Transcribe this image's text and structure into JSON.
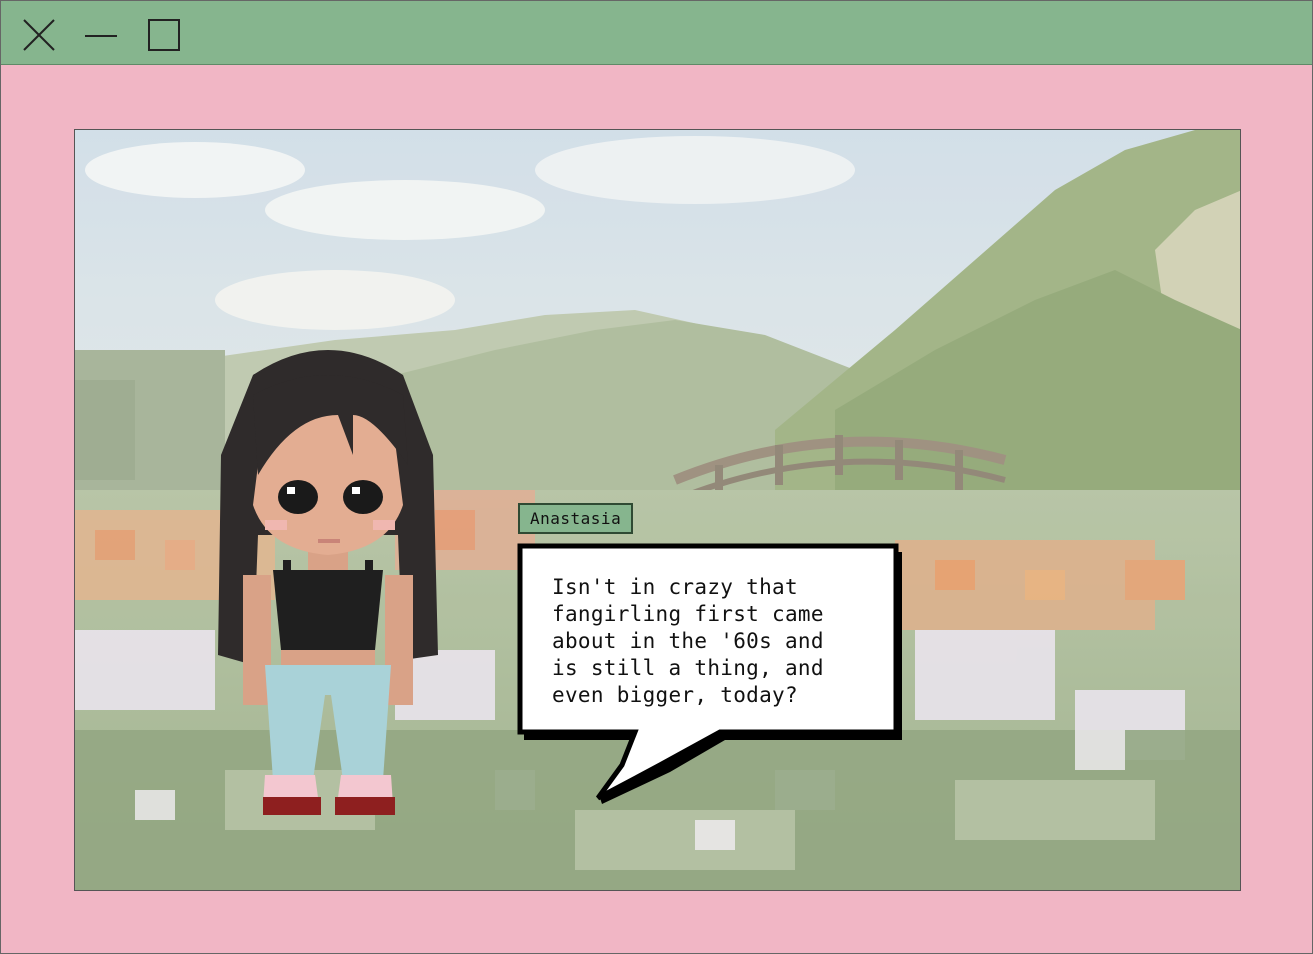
{
  "window": {
    "controls": {
      "close_icon": "close-icon",
      "minimize_icon": "minimize-icon",
      "maximize_icon": "maximize-icon"
    },
    "colors": {
      "titlebar": "#86b58e",
      "frame": "#f1b6c5"
    }
  },
  "dialogue": {
    "speaker": "Anastasia",
    "text": "Isn't in crazy that fangirling first came about in the '60s and is still a thing, and even bigger, today?"
  },
  "scene": {
    "background": "garden-with-bridge-and-hills",
    "character": "anastasia-sprite"
  }
}
